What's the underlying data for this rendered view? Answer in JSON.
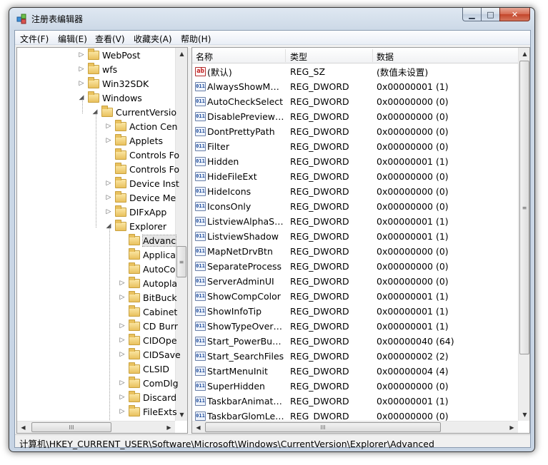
{
  "window": {
    "title": "注册表编辑器"
  },
  "menu": [
    "文件(F)",
    "编辑(E)",
    "查看(V)",
    "收藏夹(A)",
    "帮助(H)"
  ],
  "tree": [
    {
      "label": "WebPost",
      "level": 0,
      "expander": "▷"
    },
    {
      "label": "wfs",
      "level": 0,
      "expander": "▷"
    },
    {
      "label": "Win32SDK",
      "level": 0,
      "expander": "▷"
    },
    {
      "label": "Windows",
      "level": 0,
      "expander": "◢"
    },
    {
      "label": "CurrentVersio",
      "level": 1,
      "expander": "◢"
    },
    {
      "label": "Action Cen",
      "level": 2,
      "expander": "▷"
    },
    {
      "label": "Applets",
      "level": 2,
      "expander": "▷"
    },
    {
      "label": "Controls Fo",
      "level": 2,
      "expander": ""
    },
    {
      "label": "Controls Fo",
      "level": 2,
      "expander": ""
    },
    {
      "label": "Device Inst",
      "level": 2,
      "expander": "▷"
    },
    {
      "label": "Device Me",
      "level": 2,
      "expander": "▷"
    },
    {
      "label": "DIFxApp",
      "level": 2,
      "expander": "▷"
    },
    {
      "label": "Explorer",
      "level": 2,
      "expander": "◢"
    },
    {
      "label": "Advanc",
      "level": 3,
      "expander": "",
      "selected": true
    },
    {
      "label": "Applica",
      "level": 3,
      "expander": ""
    },
    {
      "label": "AutoCo",
      "level": 3,
      "expander": ""
    },
    {
      "label": "Autopla",
      "level": 3,
      "expander": "▷"
    },
    {
      "label": "BitBuck",
      "level": 3,
      "expander": "▷"
    },
    {
      "label": "Cabinet",
      "level": 3,
      "expander": ""
    },
    {
      "label": "CD Burr",
      "level": 3,
      "expander": "▷"
    },
    {
      "label": "CIDOpe",
      "level": 3,
      "expander": "▷"
    },
    {
      "label": "CIDSave",
      "level": 3,
      "expander": "▷"
    },
    {
      "label": "CLSID",
      "level": 3,
      "expander": ""
    },
    {
      "label": "ComDlg",
      "level": 3,
      "expander": "▷"
    },
    {
      "label": "Discard",
      "level": 3,
      "expander": "▷"
    },
    {
      "label": "FileExts",
      "level": 3,
      "expander": "▷"
    }
  ],
  "list": {
    "columns": {
      "name": "名称",
      "type": "类型",
      "data": "数据"
    },
    "rows": [
      {
        "kind": "sz",
        "name": "(默认)",
        "type": "REG_SZ",
        "data": "(数值未设置)"
      },
      {
        "kind": "dword",
        "name": "AlwaysShowMen...",
        "type": "REG_DWORD",
        "data": "0x00000001 (1)"
      },
      {
        "kind": "dword",
        "name": "AutoCheckSelect",
        "type": "REG_DWORD",
        "data": "0x00000000 (0)"
      },
      {
        "kind": "dword",
        "name": "DisablePreviewD...",
        "type": "REG_DWORD",
        "data": "0x00000000 (0)"
      },
      {
        "kind": "dword",
        "name": "DontPrettyPath",
        "type": "REG_DWORD",
        "data": "0x00000000 (0)"
      },
      {
        "kind": "dword",
        "name": "Filter",
        "type": "REG_DWORD",
        "data": "0x00000000 (0)"
      },
      {
        "kind": "dword",
        "name": "Hidden",
        "type": "REG_DWORD",
        "data": "0x00000001 (1)"
      },
      {
        "kind": "dword",
        "name": "HideFileExt",
        "type": "REG_DWORD",
        "data": "0x00000000 (0)"
      },
      {
        "kind": "dword",
        "name": "HideIcons",
        "type": "REG_DWORD",
        "data": "0x00000000 (0)"
      },
      {
        "kind": "dword",
        "name": "IconsOnly",
        "type": "REG_DWORD",
        "data": "0x00000000 (0)"
      },
      {
        "kind": "dword",
        "name": "ListviewAlphaSel...",
        "type": "REG_DWORD",
        "data": "0x00000001 (1)"
      },
      {
        "kind": "dword",
        "name": "ListviewShadow",
        "type": "REG_DWORD",
        "data": "0x00000001 (1)"
      },
      {
        "kind": "dword",
        "name": "MapNetDrvBtn",
        "type": "REG_DWORD",
        "data": "0x00000000 (0)"
      },
      {
        "kind": "dword",
        "name": "SeparateProcess",
        "type": "REG_DWORD",
        "data": "0x00000000 (0)"
      },
      {
        "kind": "dword",
        "name": "ServerAdminUI",
        "type": "REG_DWORD",
        "data": "0x00000000 (0)"
      },
      {
        "kind": "dword",
        "name": "ShowCompColor",
        "type": "REG_DWORD",
        "data": "0x00000001 (1)"
      },
      {
        "kind": "dword",
        "name": "ShowInfoTip",
        "type": "REG_DWORD",
        "data": "0x00000001 (1)"
      },
      {
        "kind": "dword",
        "name": "ShowTypeOverlay",
        "type": "REG_DWORD",
        "data": "0x00000001 (1)"
      },
      {
        "kind": "dword",
        "name": "Start_PowerButto...",
        "type": "REG_DWORD",
        "data": "0x00000040 (64)"
      },
      {
        "kind": "dword",
        "name": "Start_SearchFiles",
        "type": "REG_DWORD",
        "data": "0x00000002 (2)"
      },
      {
        "kind": "dword",
        "name": "StartMenuInit",
        "type": "REG_DWORD",
        "data": "0x00000004 (4)"
      },
      {
        "kind": "dword",
        "name": "SuperHidden",
        "type": "REG_DWORD",
        "data": "0x00000000 (0)"
      },
      {
        "kind": "dword",
        "name": "TaskbarAnimatio...",
        "type": "REG_DWORD",
        "data": "0x00000001 (1)"
      },
      {
        "kind": "dword",
        "name": "TaskbarGlomLevel",
        "type": "REG_DWORD",
        "data": "0x00000000 (0)"
      }
    ]
  },
  "status": {
    "path": "计算机\\HKEY_CURRENT_USER\\Software\\Microsoft\\Windows\\CurrentVersion\\Explorer\\Advanced"
  },
  "icons": {
    "sz_value": "ab",
    "dword_value": "011",
    "scroll_grip": "≡",
    "hscroll_grip": "III"
  }
}
